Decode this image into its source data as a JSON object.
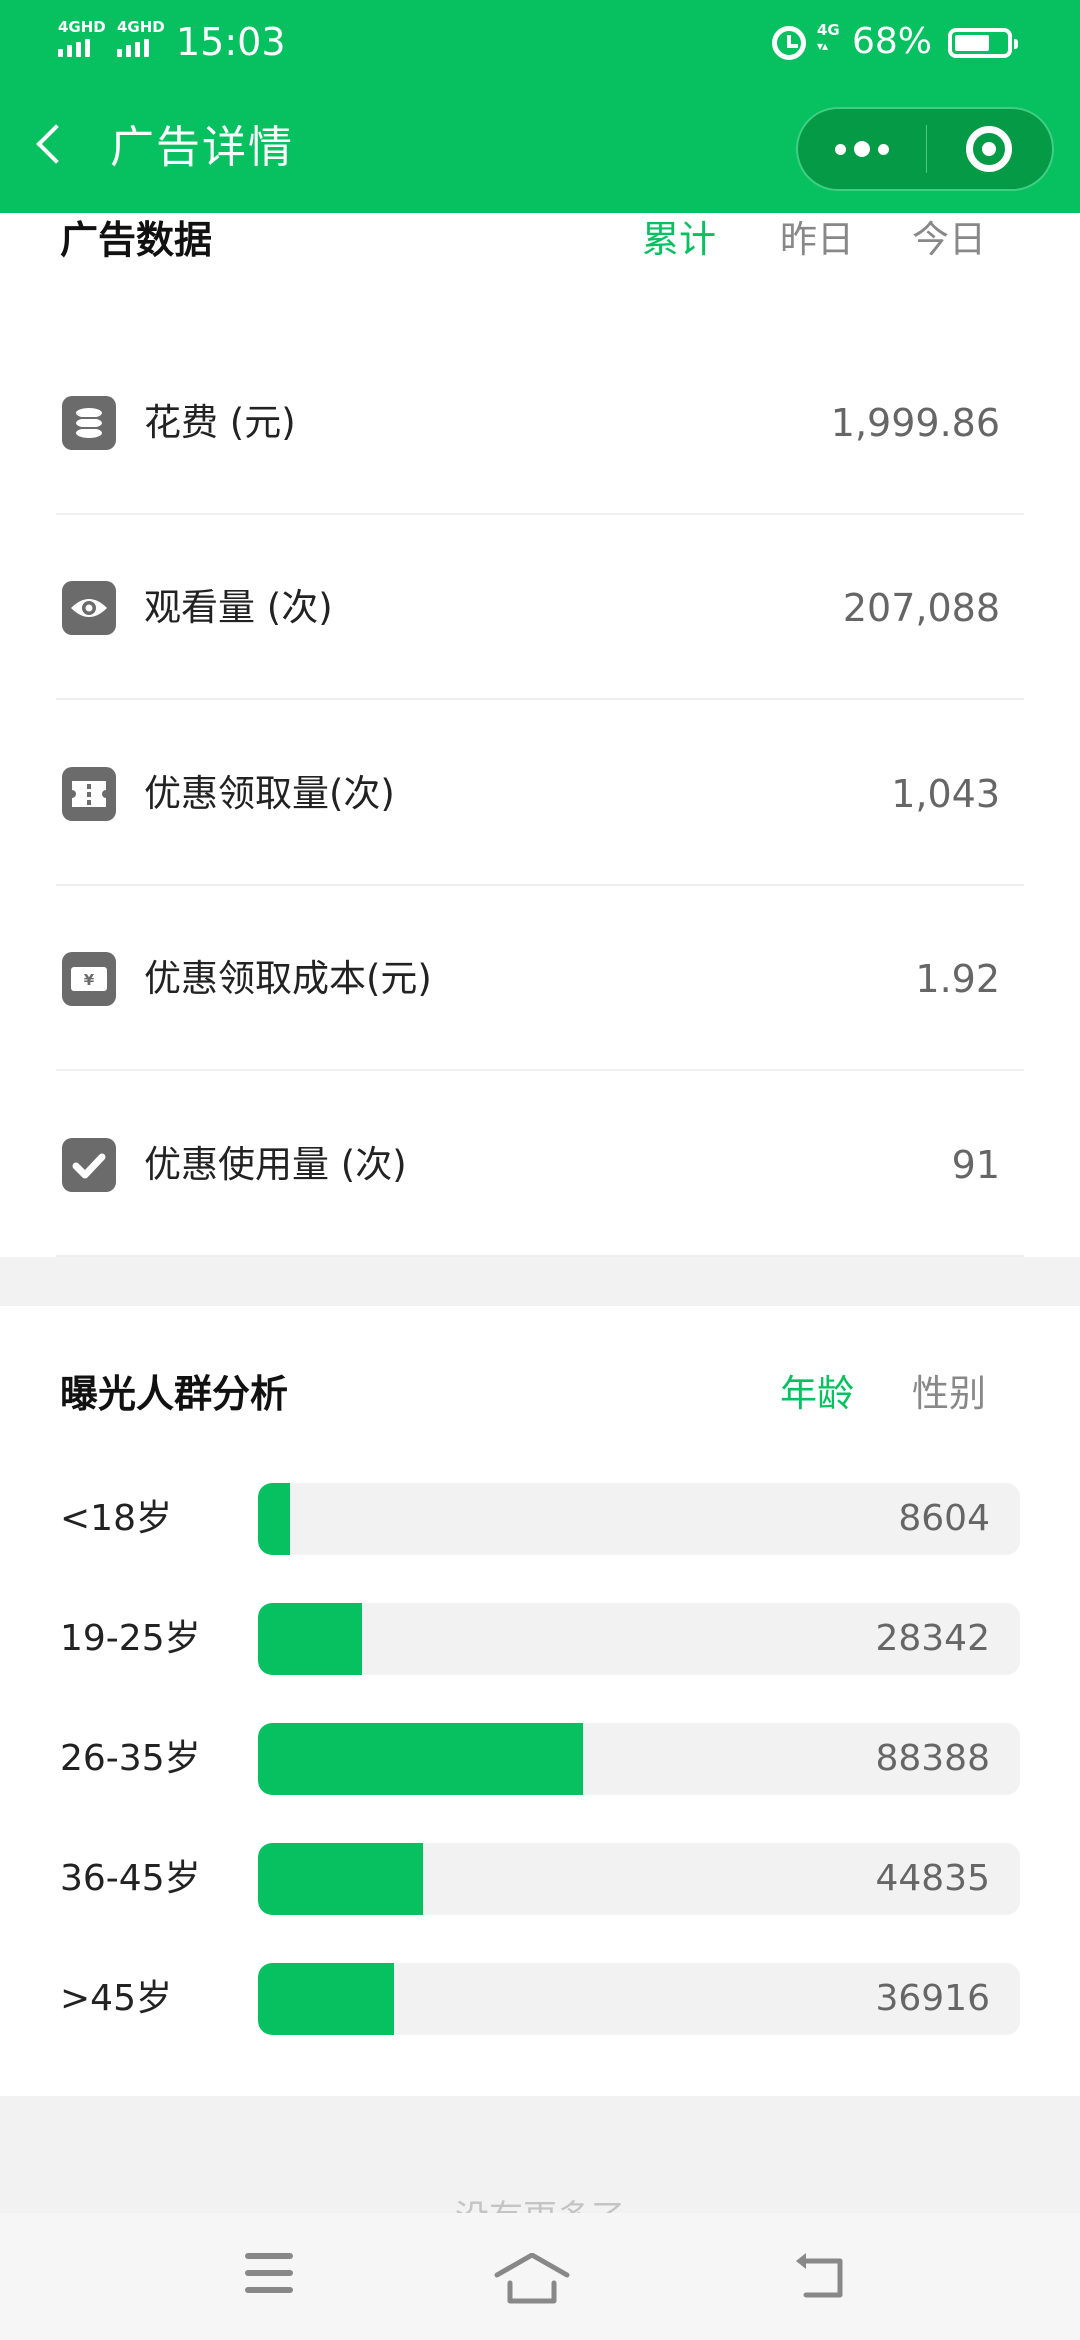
{
  "status_bar": {
    "signal_1": "4GHD",
    "signal_2": "4GHD",
    "time": "15:03",
    "network": "4G",
    "battery_percent": "68%",
    "battery_level": 0.68,
    "icons": [
      "alarm-icon",
      "4g-data-icon",
      "battery-icon"
    ]
  },
  "nav": {
    "title": "广告详情",
    "back_icon": "chevron-left-icon",
    "more_icon": "more-dots-icon",
    "close_icon": "target-close-icon"
  },
  "ad_data": {
    "title": "广告数据",
    "tabs": [
      {
        "label": "累计",
        "active": true
      },
      {
        "label": "昨日",
        "active": false
      },
      {
        "label": "今日",
        "active": false
      }
    ],
    "metrics": [
      {
        "icon": "coins-stack-icon",
        "label": "花费 (元)",
        "value": "1,999.86"
      },
      {
        "icon": "eye-icon",
        "label": "观看量 (次)",
        "value": "207,088"
      },
      {
        "icon": "ticket-icon",
        "label": "优惠领取量(次)",
        "value": "1,043"
      },
      {
        "icon": "yuan-coupon-icon",
        "label": "优惠领取成本(元)",
        "value": "1.92"
      },
      {
        "icon": "checkmark-icon",
        "label": "优惠使用量 (次)",
        "value": "91"
      }
    ]
  },
  "audience": {
    "title": "曝光人群分析",
    "tabs": [
      {
        "label": "年龄",
        "active": true
      },
      {
        "label": "性别",
        "active": false
      }
    ],
    "age_groups": [
      {
        "label": "<18岁",
        "value": "8604",
        "count": 8604
      },
      {
        "label": "19-25岁",
        "value": "28342",
        "count": 28342
      },
      {
        "label": "26-35岁",
        "value": "88388",
        "count": 88388
      },
      {
        "label": "36-45岁",
        "value": "44835",
        "count": 44835
      },
      {
        "label": ">45岁",
        "value": "36916",
        "count": 36916
      }
    ]
  },
  "footer_hint": "没有更多了",
  "system_nav": {
    "menu_icon": "menu-icon",
    "home_icon": "home-icon",
    "back_icon": "back-arrow-icon"
  },
  "colors": {
    "brand_green": "#07C160",
    "capsule_green": "#059A45",
    "icon_gray": "#6B6B6B",
    "track_gray": "#F2F2F2"
  }
}
